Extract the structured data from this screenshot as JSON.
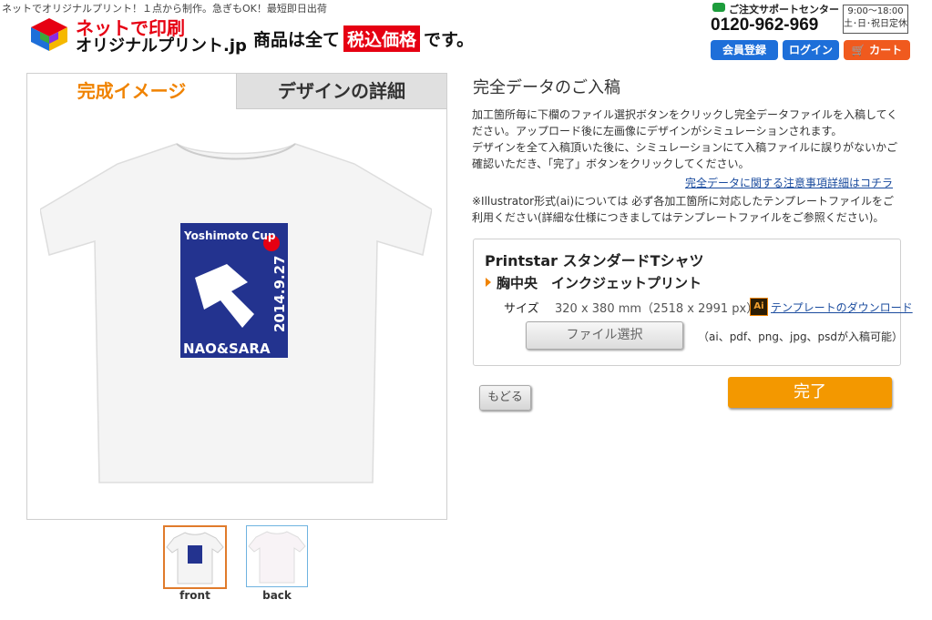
{
  "header": {
    "tagline": "ネットでオリジナルプリント！１点から制作。急ぎもOK！最短即日出荷",
    "logo_line1": "ネットで印刷",
    "logo_line2": "オリジナルプリント.jp",
    "tax_prefix": "商品は全て",
    "tax_highlight": "税込価格",
    "tax_suffix": "です。",
    "support_label": "ご注文サポートセンター",
    "phone": "0120-962-969",
    "hours_line1": "9:00～18:00",
    "hours_line2": "土･日･祝日定休",
    "member_label": "会員登録",
    "login_label": "ログイン",
    "cart_label": "カート"
  },
  "preview": {
    "tab_image": "完成イメージ",
    "tab_design": "デザインの詳細",
    "shirt_text_top": "Yoshimoto Cup",
    "shirt_date": "2014.9.27",
    "shirt_names": "NAO&SARA",
    "thumbs": [
      {
        "label": "front"
      },
      {
        "label": "back"
      }
    ]
  },
  "main": {
    "title": "完全データのご入稿",
    "para1_line1": "加工箇所毎に下欄のファイル選択ボタンをクリックし完全データファイルを入稿してく",
    "para1_line2": "ださい。アップロード後に左画像にデザインがシミュレーションされます。",
    "para1_line3": "デザインを全て入稿頂いた後に、シミュレーションにて入稿ファイルに誤りがないかご",
    "para1_line4": "確認いただき、「完了」ボタンをクリックしてください。",
    "notes_link": "完全データに関する注意事項詳細はコチラ",
    "para2_line1": "※Illustrator形式(ai)については 必ず各加工箇所に対応したテンプレートファイルをご",
    "para2_line2": "利用ください(詳細な仕様につきましてはテンプレートファイルをご参照ください)。",
    "product_name": "Printstar スタンダードTシャツ",
    "print_position": "胸中央　インクジェットプリント",
    "size_label": "サイズ",
    "size_value": "320 x 380 mm（2518 x 2991 px）",
    "ai_icon_text": "Ai",
    "template_link": "テンプレートのダウンロード",
    "file_button": "ファイル選択",
    "file_note": "（ai、pdf、png、jpg、psdが入稿可能）",
    "back_button": "もどる",
    "done_button": "完了"
  },
  "colors": {
    "accent_orange": "#f39800",
    "brand_red": "#e60012",
    "link_blue": "#1a4b9e",
    "print_navy": "#23338f"
  }
}
